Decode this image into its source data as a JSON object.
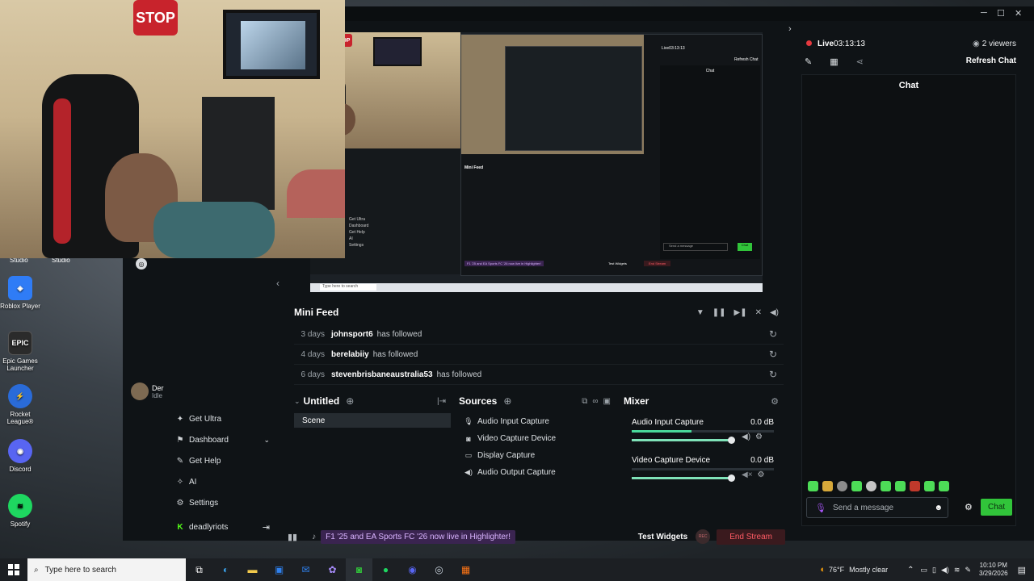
{
  "desktop": {
    "top_labels": [
      "Studio",
      "Studio"
    ],
    "icons": [
      {
        "label": "Roblox Player",
        "icon": "roblox-icon",
        "color": "#2f7cf6"
      },
      {
        "label": "Epic Games Launcher",
        "icon": "epic-games-icon",
        "color": "#2b2b2b"
      },
      {
        "label": "Rocket League®",
        "icon": "rocket-league-icon",
        "color": "#2a6bd8"
      },
      {
        "label": "Discord",
        "icon": "discord-icon",
        "color": "#5865f2"
      },
      {
        "label": "Spotify",
        "icon": "spotify-icon",
        "color": "#1ed760"
      }
    ]
  },
  "webcam": {
    "stop_sign": "STOP"
  },
  "studio": {
    "preview": {
      "stop_sign": "STOP",
      "nested_live": "Live03:13:13",
      "nested_refresh": "Refresh Chat",
      "nested_chat": "Chat",
      "nested_feed_title": "Mini Feed",
      "nested_send": "Send a message",
      "nested_chat_btn": "Chat",
      "nested_banner": "F1 '25 and EA Sports FC '26 now live in Highlighter!",
      "nested_test_widgets": "Test Widgets",
      "nested_end": "End Stream",
      "nested_search": "Type here to search"
    },
    "profile": {
      "name": "Der",
      "status": "Idle"
    },
    "sidebar": [
      {
        "label": "Get Ultra",
        "icon": "ultra-icon"
      },
      {
        "label": "Dashboard",
        "icon": "dashboard-icon",
        "caret": "⌄"
      },
      {
        "label": "Get Help",
        "icon": "help-icon"
      },
      {
        "label": "AI",
        "icon": "ai-icon"
      },
      {
        "label": "Settings",
        "icon": "gear-icon"
      },
      {
        "label": "deadlyriots",
        "icon": "kick-icon",
        "trailing": "⇥"
      }
    ],
    "mini_feed": {
      "title": "Mini Feed",
      "rows": [
        {
          "ago": "3 days",
          "user": "johnsport6",
          "action": "has followed"
        },
        {
          "ago": "4 days",
          "user": "berelabiiy",
          "action": "has followed"
        },
        {
          "ago": "6 days",
          "user": "stevenbrisbaneaustralia53",
          "action": "has followed"
        }
      ]
    },
    "scenes": {
      "title": "Untitled",
      "items": [
        "Scene"
      ]
    },
    "sources": {
      "title": "Sources",
      "items": [
        {
          "label": "Audio Input Capture",
          "icon": "microphone-icon"
        },
        {
          "label": "Video Capture Device",
          "icon": "camera-icon"
        },
        {
          "label": "Display Capture",
          "icon": "monitor-icon"
        },
        {
          "label": "Audio Output Capture",
          "icon": "speaker-icon"
        }
      ]
    },
    "mixer": {
      "title": "Mixer",
      "channels": [
        {
          "name": "Audio Input Capture",
          "db": "0.0 dB",
          "level": 0.42
        },
        {
          "name": "Video Capture Device",
          "db": "0.0 dB",
          "level": 0.0
        }
      ]
    },
    "bottom": {
      "banner": "F1 '25 and EA Sports FC '26 now live in Highlighter!",
      "test_widgets": "Test Widgets",
      "rec": "REC",
      "end_stream": "End Stream"
    }
  },
  "live_panel": {
    "live_label": "Live",
    "live_time": "03:13:13",
    "viewers": "2 viewers",
    "refresh_chat": "Refresh Chat",
    "chat_title": "Chat",
    "send_placeholder": "Send a message",
    "chat_button": "Chat"
  },
  "taskbar": {
    "search_placeholder": "Type here to search",
    "weather_temp": "76°F",
    "weather_desc": "Mostly clear",
    "time": "10:10 PM",
    "date": "3/29/2026"
  },
  "colors": {
    "accent_green": "#31c43a",
    "live_red": "#e5393f",
    "banner_purple": "#3a2450"
  }
}
